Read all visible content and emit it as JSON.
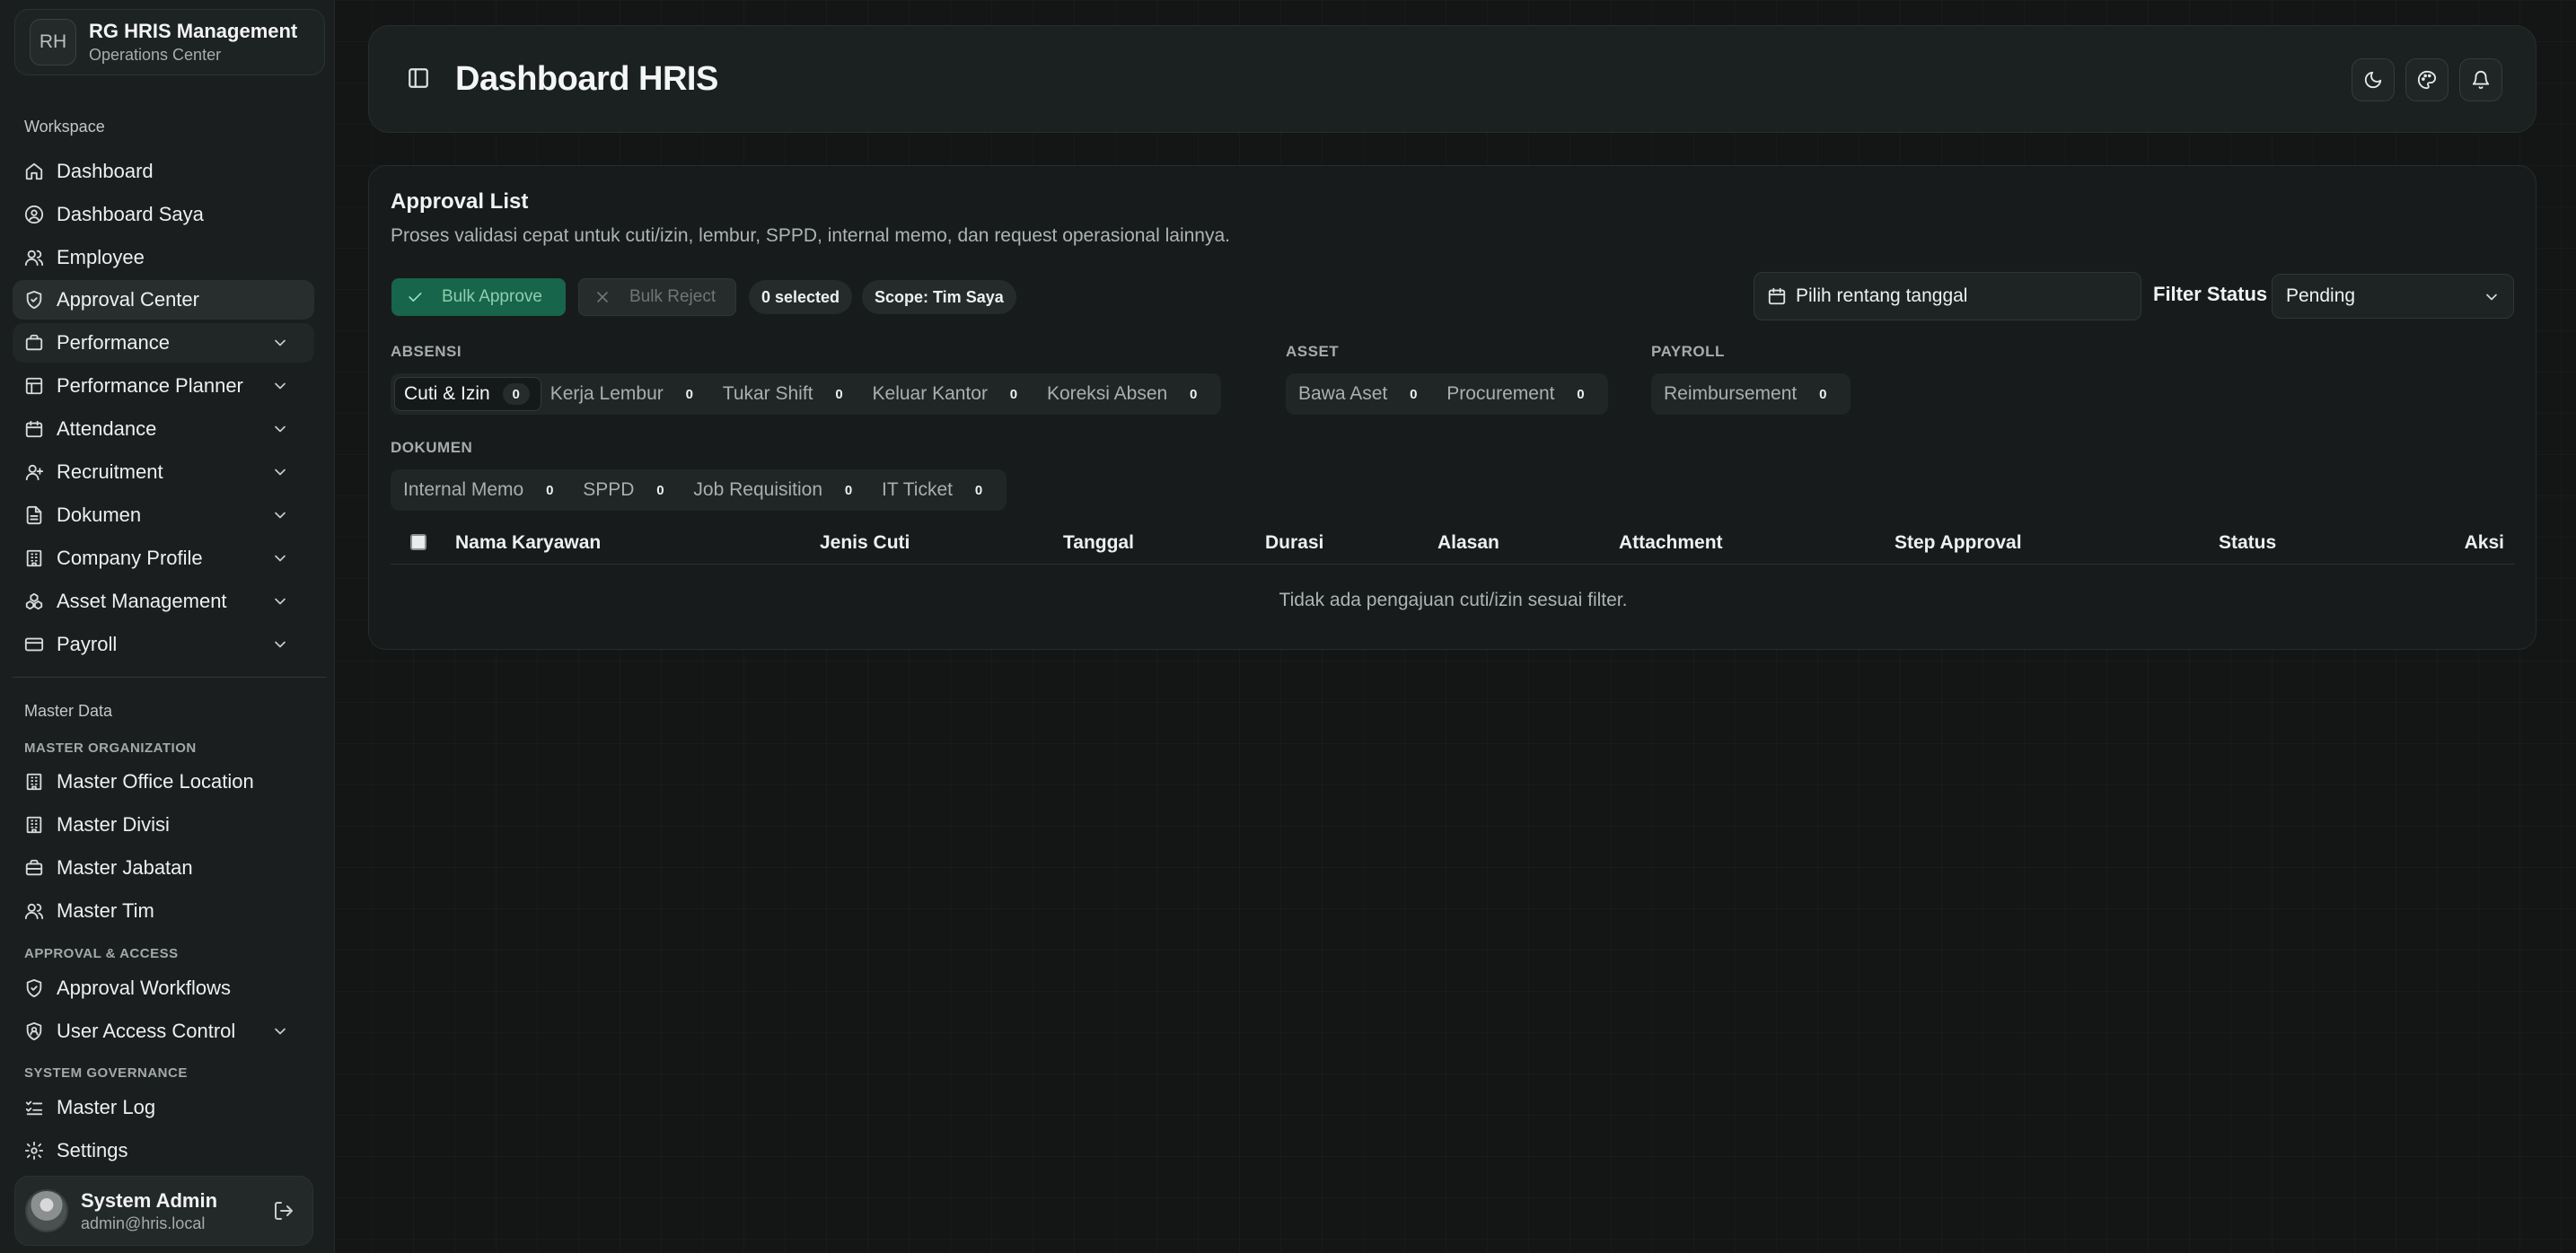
{
  "brand": {
    "logo_text": "RH",
    "title": "RG HRIS Management",
    "subtitle": "Operations Center"
  },
  "sidebar": {
    "workspace_label": "Workspace",
    "workspace_items": [
      {
        "label": "Dashboard",
        "icon": "home-icon"
      },
      {
        "label": "Dashboard Saya",
        "icon": "user-circle-icon"
      },
      {
        "label": "Employee",
        "icon": "users-icon"
      },
      {
        "label": "Approval Center",
        "icon": "shield-check-icon"
      },
      {
        "label": "Performance",
        "icon": "briefcase-icon"
      },
      {
        "label": "Performance Planner",
        "icon": "layout-icon"
      },
      {
        "label": "Attendance",
        "icon": "calendar-icon"
      },
      {
        "label": "Recruitment",
        "icon": "user-plus-icon"
      },
      {
        "label": "Dokumen",
        "icon": "file-icon"
      },
      {
        "label": "Company Profile",
        "icon": "building-icon"
      },
      {
        "label": "Asset Management",
        "icon": "boxes-icon"
      },
      {
        "label": "Payroll",
        "icon": "credit-card-icon"
      }
    ],
    "master_label": "Master Data",
    "group_org": "MASTER ORGANIZATION",
    "org_items": [
      {
        "label": "Master Office Location",
        "icon": "building-icon"
      },
      {
        "label": "Master Divisi",
        "icon": "building-icon"
      },
      {
        "label": "Master Jabatan",
        "icon": "briefcase-icon"
      },
      {
        "label": "Master Tim",
        "icon": "users-icon"
      }
    ],
    "group_access": "APPROVAL & ACCESS",
    "access_items": [
      {
        "label": "Approval Workflows",
        "icon": "shield-check-icon"
      },
      {
        "label": "User Access Control",
        "icon": "shield-user-icon"
      }
    ],
    "group_gov": "SYSTEM GOVERNANCE",
    "gov_items": [
      {
        "label": "Master Log",
        "icon": "list-checks-icon"
      },
      {
        "label": "Settings",
        "icon": "gear-icon"
      }
    ]
  },
  "user": {
    "name": "System Admin",
    "email": "admin@hris.local"
  },
  "header": {
    "title": "Dashboard HRIS"
  },
  "approval": {
    "title": "Approval List",
    "description": "Proses validasi cepat untuk cuti/izin, lembur, SPPD, internal memo, dan request operasional lainnya.",
    "bulk_approve": "Bulk Approve",
    "bulk_reject": "Bulk Reject",
    "selected_count": "0 selected",
    "scope": "Scope: Tim Saya",
    "date_placeholder": "Pilih rentang tanggal",
    "filter_label": "Filter Status",
    "filter_value": "Pending",
    "categories": {
      "absensi": {
        "label": "ABSENSI",
        "tabs": [
          {
            "label": "Cuti & Izin",
            "count": "0"
          },
          {
            "label": "Kerja Lembur",
            "count": "0"
          },
          {
            "label": "Tukar Shift",
            "count": "0"
          },
          {
            "label": "Keluar Kantor",
            "count": "0"
          },
          {
            "label": "Koreksi Absen",
            "count": "0"
          }
        ]
      },
      "asset": {
        "label": "ASSET",
        "tabs": [
          {
            "label": "Bawa Aset",
            "count": "0"
          },
          {
            "label": "Procurement",
            "count": "0"
          }
        ]
      },
      "payroll": {
        "label": "PAYROLL",
        "tabs": [
          {
            "label": "Reimbursement",
            "count": "0"
          }
        ]
      },
      "dokumen": {
        "label": "DOKUMEN",
        "tabs": [
          {
            "label": "Internal Memo",
            "count": "0"
          },
          {
            "label": "SPPD",
            "count": "0"
          },
          {
            "label": "Job Requisition",
            "count": "0"
          },
          {
            "label": "IT Ticket",
            "count": "0"
          }
        ]
      }
    },
    "columns": [
      "Nama Karyawan",
      "Jenis Cuti",
      "Tanggal",
      "Durasi",
      "Alasan",
      "Attachment",
      "Step Approval",
      "Status",
      "Aksi"
    ],
    "empty_message": "Tidak ada pengajuan cuti/izin sesuai filter."
  },
  "colors": {
    "accent_approve": "#17654a",
    "background": "#141616"
  }
}
